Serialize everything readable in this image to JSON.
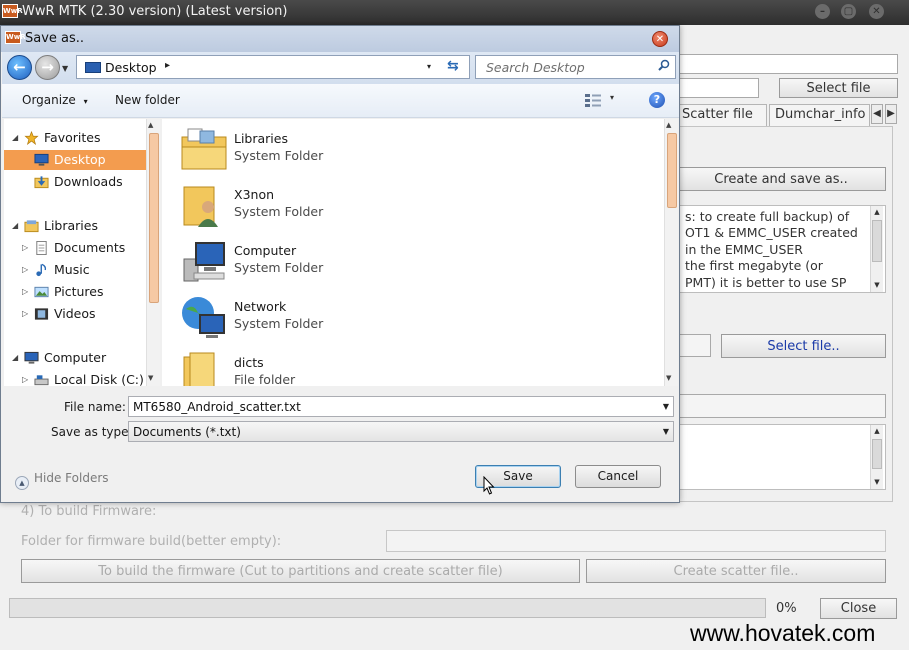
{
  "app": {
    "title": "WwR MTK (2.30 version) (Latest version)",
    "logo_text": "WwR",
    "window_controls": {
      "minimize": "–",
      "maximize": "▢",
      "close": "✕"
    },
    "select_file_top": "Select file",
    "tabs": [
      "Scatter file",
      "Dumchar_info"
    ],
    "create_save_button": "Create and save as..",
    "info_text_lines": [
      "s: to create full backup) of",
      "OT1 & EMMC_USER created",
      " in the EMMC_USER",
      " the first megabyte (or",
      "PMT) it is better to use SP",
      ""
    ],
    "select_file_mid": "Select file..",
    "section4_label": "4) To build Firmware:",
    "folder_label": "Folder for firmware build(better empty):",
    "build_button": "To build the firmware (Cut to partitions and create scatter file)",
    "create_scatter_button": "Create scatter file..",
    "progress_percent": "0%",
    "progress_value": 0,
    "close_button": "Close",
    "watermark": "www.hovatek.com"
  },
  "dialog": {
    "title": "Save as..",
    "close_glyph": "✕",
    "address": {
      "location": "Desktop",
      "arrow": "▸",
      "drop": "▾",
      "refresh_glyph": "⇆"
    },
    "search_placeholder": "Search Desktop",
    "toolbar": {
      "organize": "Organize",
      "organize_arrow": "▾",
      "new_folder": "New folder",
      "views_arrow": "▾",
      "help": "?"
    },
    "tree": [
      {
        "label": "Favorites",
        "icon": "star-icon",
        "expander": "◢",
        "level": 0
      },
      {
        "label": "Desktop",
        "icon": "desktop-icon",
        "expander": "",
        "level": 1,
        "selected": true
      },
      {
        "label": "Downloads",
        "icon": "downloads-icon",
        "expander": "",
        "level": 1
      },
      {
        "label": "Libraries",
        "icon": "libraries-icon",
        "expander": "◢",
        "level": 0
      },
      {
        "label": "Documents",
        "icon": "documents-icon",
        "expander": "▷",
        "level": 1
      },
      {
        "label": "Music",
        "icon": "music-icon",
        "expander": "▷",
        "level": 1
      },
      {
        "label": "Pictures",
        "icon": "pictures-icon",
        "expander": "▷",
        "level": 1
      },
      {
        "label": "Videos",
        "icon": "videos-icon",
        "expander": "▷",
        "level": 1
      },
      {
        "label": "Computer",
        "icon": "computer-icon",
        "expander": "◢",
        "level": 0
      },
      {
        "label": "Local Disk (C:)",
        "icon": "local-disk-icon",
        "expander": "▷",
        "level": 1
      }
    ],
    "files": [
      {
        "name": "Libraries",
        "type": "System Folder",
        "icon": "libraries-folder-icon"
      },
      {
        "name": "X3non",
        "type": "System Folder",
        "icon": "user-folder-icon"
      },
      {
        "name": "Computer",
        "type": "System Folder",
        "icon": "computer-icon"
      },
      {
        "name": "Network",
        "type": "System Folder",
        "icon": "network-icon"
      },
      {
        "name": "dicts",
        "type": "File folder",
        "icon": "folder-icon"
      }
    ],
    "file_name_label": "File name:",
    "file_name_value": "MT6580_Android_scatter.txt",
    "save_type_label": "Save as type:",
    "save_type_value": "Documents (*.txt)",
    "hide_folders": "Hide Folders",
    "save_button": "Save",
    "cancel_button": "Cancel"
  }
}
